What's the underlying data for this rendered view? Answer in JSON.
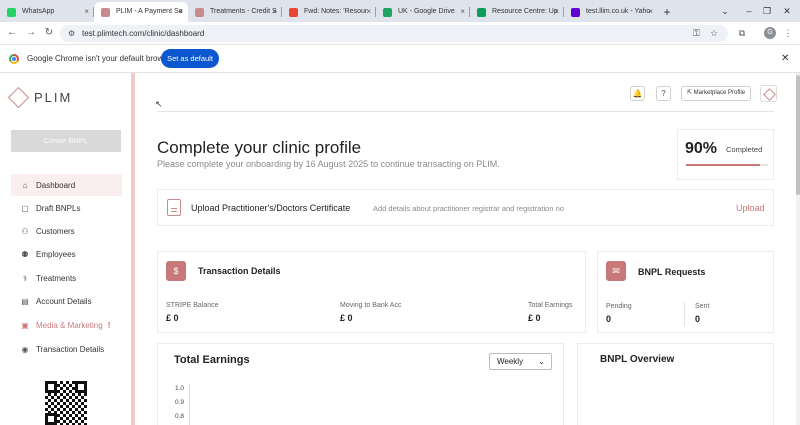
{
  "browser": {
    "tabs": [
      {
        "label": "WhatsApp",
        "favicon_color": "#25d366",
        "active": false
      },
      {
        "label": "PLIM - A Payment So",
        "favicon_color": "#c88a8a",
        "active": true
      },
      {
        "label": "Treatments - Credit S",
        "favicon_color": "#c88a8a",
        "active": false
      },
      {
        "label": "Fwd: Notes: 'Resour",
        "favicon_color": "#ea4335",
        "active": false
      },
      {
        "label": "UK - Google Drive",
        "favicon_color": "#1fa463",
        "active": false
      },
      {
        "label": "Resource Centre: Up",
        "favicon_color": "#0f9d58",
        "active": false
      },
      {
        "label": "test.llim.co.uk - Yaho",
        "favicon_color": "#6001d2",
        "active": false
      }
    ],
    "tab_close_glyph": "×",
    "new_tab_glyph": "+",
    "window_controls": [
      "⌄",
      "–",
      "❐",
      "✕"
    ],
    "nav_glyphs": {
      "back": "←",
      "forward": "→",
      "reload": "↻"
    },
    "url": "test.plimtech.com/clinic/dashboard",
    "profile_initial": "G",
    "infobar": {
      "message": "Google Chrome isn't your default browser",
      "button": "Set as default",
      "close": "✕"
    }
  },
  "sidebar": {
    "brand": "PLIM",
    "create_button": "Create BNPL",
    "items": [
      {
        "label": "Dashboard",
        "icon": "dashboard-icon",
        "glyph": "⌂",
        "active": true
      },
      {
        "label": "Draft BNPLs",
        "icon": "draft-icon",
        "glyph": "▢",
        "active": false
      },
      {
        "label": "Customers",
        "icon": "customers-icon",
        "glyph": "⚇",
        "active": false
      },
      {
        "label": "Employees",
        "icon": "employees-icon",
        "glyph": "⚉",
        "active": false
      },
      {
        "label": "Treatments",
        "icon": "treatments-icon",
        "glyph": "⚕",
        "active": false
      },
      {
        "label": "Account Details",
        "icon": "account-icon",
        "glyph": "▤",
        "active": false
      },
      {
        "label": "Media & Marketing",
        "icon": "media-icon",
        "glyph": "▣",
        "active": false,
        "alert": "!"
      },
      {
        "label": "Transaction Details",
        "icon": "transaction-icon",
        "glyph": "◉",
        "active": false
      }
    ]
  },
  "header": {
    "bell_glyph": "🔔",
    "help_glyph": "?",
    "marketplace_button": "Marketplace Profile"
  },
  "profile_section": {
    "title": "Complete your clinic profile",
    "subtitle": "Please complete your onboarding by 16 August 2025 to continue transacting on PLIM.",
    "progress_value": "90%",
    "progress_fraction": 0.9,
    "progress_label": "Completed"
  },
  "upload": {
    "title": "Upload Practitioner's/Doctors Certificate",
    "description": "Add details about practitioner registrar and registration no",
    "link": "Upload"
  },
  "transaction_details": {
    "title": "Transaction Details",
    "icon_glyph": "$",
    "fields": [
      {
        "label": "STRIPE Balance",
        "value": "£ 0"
      },
      {
        "label": "Moving to Bank Acc",
        "value": "£ 0"
      },
      {
        "label": "Total Earnings",
        "value": "£ 0"
      }
    ]
  },
  "bnpl_requests": {
    "title": "BNPL Requests",
    "icon_glyph": "✉",
    "fields": [
      {
        "label": "Pending",
        "value": "0"
      },
      {
        "label": "Sent",
        "value": "0"
      }
    ]
  },
  "total_earnings": {
    "title": "Total Earnings",
    "period_select": "Weekly",
    "chevron": "⌄",
    "y_ticks": [
      "1.0",
      "0.9",
      "0.8"
    ]
  },
  "bnpl_overview": {
    "title": "BNPL Overview"
  },
  "colors": {
    "accent": "#c87878",
    "chrome_blue": "#0b57d0"
  }
}
